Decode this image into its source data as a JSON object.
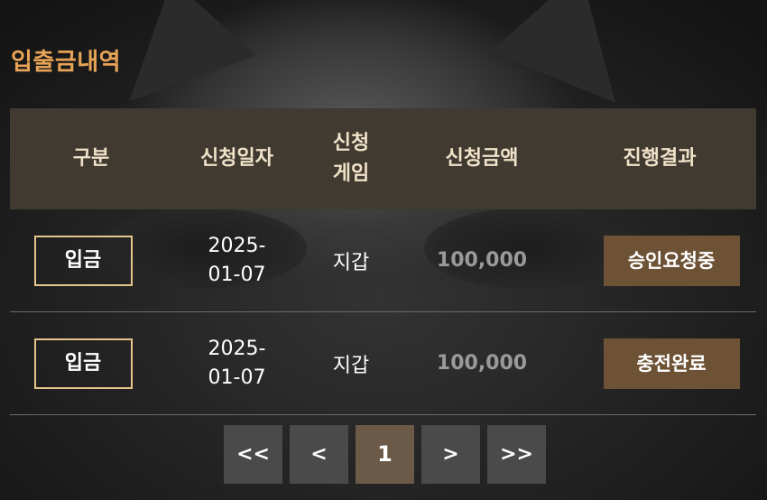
{
  "page_title": "입출금내역",
  "table": {
    "headers": [
      "구분",
      "신청일자",
      "신청게임",
      "신청금액",
      "진행결과"
    ],
    "rows": [
      {
        "type": "입금",
        "date_line1": "2025-",
        "date_line2": "01-07",
        "game": "지갑",
        "amount": "100,000",
        "status": "승인요청중"
      },
      {
        "type": "입금",
        "date_line1": "2025-",
        "date_line2": "01-07",
        "game": "지갑",
        "amount": "100,000",
        "status": "충전완료"
      }
    ]
  },
  "pagination": {
    "first": "<<",
    "prev": "<",
    "current": "1",
    "next": ">",
    "last": ">>"
  },
  "colors": {
    "accent_title": "#e8a456",
    "header_bg": "#403a31",
    "status_bg": "#6e5236",
    "active_page_bg": "#6b5a48"
  }
}
